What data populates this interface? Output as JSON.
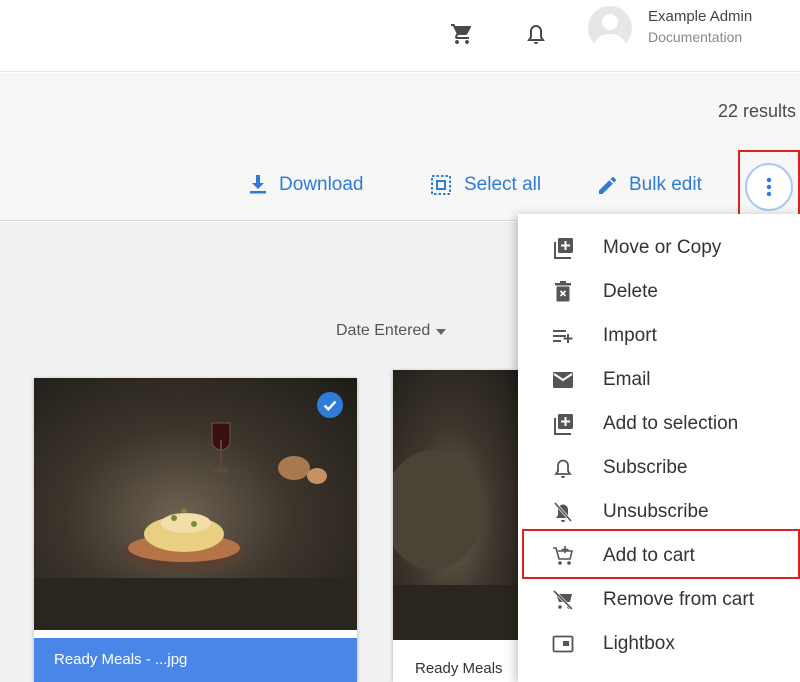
{
  "header": {
    "user_name": "Example Admin",
    "user_org": "Documentation",
    "icons": [
      "cart-icon",
      "bell-icon",
      "avatar"
    ]
  },
  "toolbar": {
    "results": "22 results",
    "download": "Download",
    "select_all": "Select all",
    "bulk_edit": "Bulk edit"
  },
  "sort": {
    "label": "Date Entered"
  },
  "cards": [
    {
      "caption": "Ready Meals - ...jpg",
      "selected": true
    },
    {
      "caption": "Ready Meals",
      "selected": false
    }
  ],
  "menu": {
    "items": [
      {
        "label": "Move or Copy",
        "icon": "library-add-icon"
      },
      {
        "label": "Delete",
        "icon": "trash-icon"
      },
      {
        "label": "Import",
        "icon": "playlist-add-icon"
      },
      {
        "label": "Email",
        "icon": "mail-icon"
      },
      {
        "label": "Add to selection",
        "icon": "library-add-icon"
      },
      {
        "label": "Subscribe",
        "icon": "bell-icon"
      },
      {
        "label": "Unsubscribe",
        "icon": "bell-off-icon"
      },
      {
        "label": "Add to cart",
        "icon": "cart-add-icon"
      },
      {
        "label": "Remove from cart",
        "icon": "cart-remove-icon"
      },
      {
        "label": "Lightbox",
        "icon": "lightbox-icon"
      }
    ]
  },
  "colors": {
    "accent": "#2f7bd8",
    "caption_bg": "#4a86e8",
    "highlight": "#d9231f"
  }
}
